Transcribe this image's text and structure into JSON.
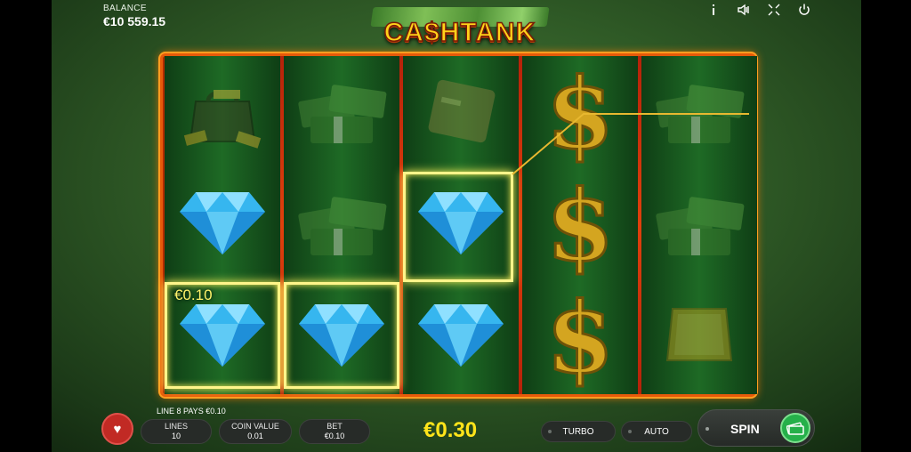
{
  "header": {
    "balance_label": "BALANCE",
    "balance_value": "€10 559.15",
    "icons": [
      "info-icon",
      "sound-icon",
      "fullscreen-icon",
      "power-icon"
    ]
  },
  "logo": {
    "text": "CA$HTANK"
  },
  "reels": {
    "columns": [
      [
        "bag-of-gold",
        "diamond",
        "diamond"
      ],
      [
        "cash-stack",
        "cash-stack",
        "diamond"
      ],
      [
        "gold-card",
        "diamond",
        "diamond"
      ],
      [
        "dollar-sign",
        "dollar-sign",
        "dollar-sign"
      ],
      [
        "cash-stack",
        "cash-stack",
        "gold-bar"
      ]
    ],
    "winning_cells": [
      [
        0,
        2
      ],
      [
        1,
        2
      ],
      [
        2,
        1
      ]
    ],
    "win_amount": "€0.10"
  },
  "bottom": {
    "line_pays": "LINE 8 PAYS €0.10",
    "lines_label": "LINES",
    "lines_value": "10",
    "coin_label": "COIN VALUE",
    "coin_value": "0.01",
    "bet_label": "BET",
    "bet_value": "€0.10",
    "total": "€0.30",
    "turbo_label": "TURBO",
    "auto_label": "AUTO",
    "spin_label": "SPIN"
  },
  "colors": {
    "frame": "#e65a0a",
    "win_highlight": "#fff58a",
    "total_text": "#ffe41a",
    "spin_icon": "#25b04a"
  }
}
